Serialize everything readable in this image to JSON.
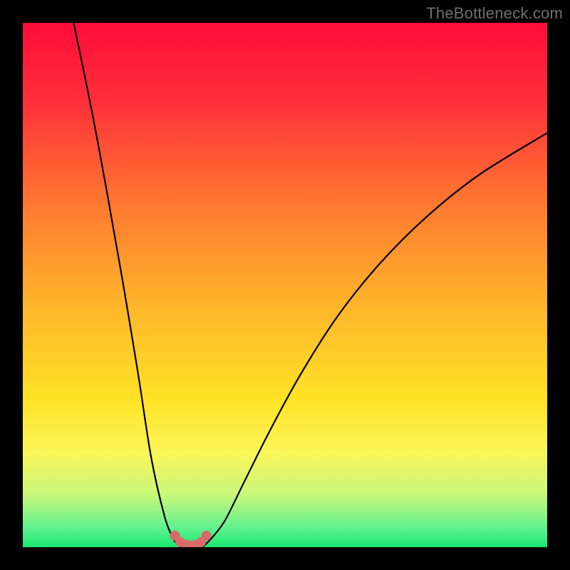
{
  "watermark": "TheBottleneck.com",
  "chart_data": {
    "type": "line",
    "title": "",
    "xlabel": "",
    "ylabel": "",
    "xlim": [
      0,
      100
    ],
    "ylim": [
      0,
      100
    ],
    "grid": false,
    "legend": false,
    "series": [
      {
        "name": "left-curve",
        "x": [
          9.7,
          13.0,
          16.0,
          19.0,
          22.0,
          24.5,
          27.0,
          28.5,
          29.5,
          30.3
        ],
        "values": [
          100,
          84,
          68,
          51,
          33,
          17,
          6,
          2,
          0.5,
          0
        ]
      },
      {
        "name": "right-curve",
        "x": [
          34.2,
          35.8,
          38.5,
          42.0,
          47.0,
          53.0,
          60.0,
          68.0,
          77.0,
          87.0,
          100.0
        ],
        "values": [
          0,
          1.5,
          5,
          12,
          22,
          33,
          44,
          54,
          63,
          71,
          79
        ]
      },
      {
        "name": "bottom-dots",
        "x": [
          29.0,
          30.0,
          31.0,
          32.0,
          33.0,
          34.0,
          35.0
        ],
        "values": [
          2.2,
          1.0,
          0.5,
          0.3,
          0.5,
          1.0,
          2.2
        ]
      }
    ],
    "gradient_stops": [
      {
        "offset": 0.0,
        "color": "#ff0b3a"
      },
      {
        "offset": 0.15,
        "color": "#ff2f3a"
      },
      {
        "offset": 0.35,
        "color": "#ff7a30"
      },
      {
        "offset": 0.55,
        "color": "#ffb82a"
      },
      {
        "offset": 0.72,
        "color": "#ffe326"
      },
      {
        "offset": 0.82,
        "color": "#fbf65a"
      },
      {
        "offset": 0.9,
        "color": "#c8f77a"
      },
      {
        "offset": 0.965,
        "color": "#5ef28f"
      },
      {
        "offset": 1.0,
        "color": "#19e86f"
      }
    ],
    "dot_color": "#d86a6a",
    "line_color": "#000000"
  }
}
